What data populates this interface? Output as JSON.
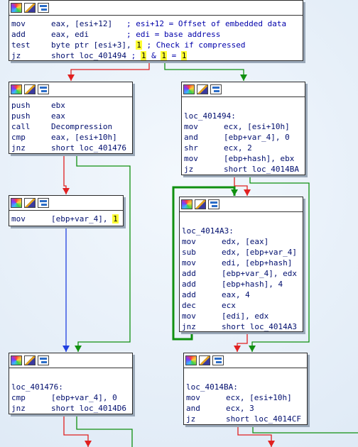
{
  "nodes": {
    "n1": {
      "rows": [
        {
          "m": "mov",
          "o": "eax, [esi+12]   ; esi+12 = Offset of embedded data"
        },
        {
          "m": "add",
          "o": "eax, edi        ; edi = base address"
        },
        {
          "m": "test",
          "o": "byte ptr [esi+3], ",
          "hl": "1",
          "t": " ; Check if compressed"
        },
        {
          "m": "jz",
          "o": "short loc_401494 ; ",
          "hl": "1",
          "t": " & ",
          "hl2": "1",
          "t2": " = ",
          "hl3": "1"
        }
      ]
    },
    "n2": {
      "rows": [
        {
          "m": "push",
          "o": "ebx"
        },
        {
          "m": "push",
          "o": "eax"
        },
        {
          "m": "call",
          "o": "Decompression"
        },
        {
          "m": "cmp",
          "o": "eax, [esi+10h]"
        },
        {
          "m": "jnz",
          "o": "short loc_401476"
        }
      ]
    },
    "n3": {
      "label": "loc_401494:",
      "rows": [
        {
          "m": "mov",
          "o": "ecx, [esi+10h]"
        },
        {
          "m": "and",
          "o": "[ebp+var_4], 0"
        },
        {
          "m": "shr",
          "o": "ecx, 2"
        },
        {
          "m": "mov",
          "o": "[ebp+hash], ebx"
        },
        {
          "m": "jz",
          "o": "short loc_4014BA"
        }
      ]
    },
    "n4": {
      "rows": [
        {
          "m": "mov",
          "o": "[ebp+var_4], ",
          "hl": "1"
        }
      ]
    },
    "n5": {
      "label": "loc_4014A3:",
      "rows": [
        {
          "m": "mov",
          "o": "edx, [eax]"
        },
        {
          "m": "sub",
          "o": "edx, [ebp+var_4]"
        },
        {
          "m": "mov",
          "o": "edi, [ebp+hash]"
        },
        {
          "m": "add",
          "o": "[ebp+var_4], edx"
        },
        {
          "m": "add",
          "o": "[ebp+hash], 4"
        },
        {
          "m": "add",
          "o": "eax, 4"
        },
        {
          "m": "dec",
          "o": "ecx"
        },
        {
          "m": "mov",
          "o": "[edi], edx"
        },
        {
          "m": "jnz",
          "o": "short loc_4014A3"
        }
      ]
    },
    "n6": {
      "label": "loc_401476:",
      "rows": [
        {
          "m": "cmp",
          "o": "[ebp+var_4], 0"
        },
        {
          "m": "jnz",
          "o": "short loc_4014D6"
        }
      ]
    },
    "n7": {
      "label": "loc_4014BA:",
      "rows": [
        {
          "m": "mov",
          "o": "ecx, [esi+10h]"
        },
        {
          "m": "and",
          "o": "ecx, 3"
        },
        {
          "m": "jz",
          "o": "short loc_4014CF"
        }
      ]
    }
  },
  "colors": {
    "edge_false": "#e02020",
    "edge_true": "#109010",
    "edge_uncond": "#2040e0",
    "highlight": "#ffff33"
  }
}
